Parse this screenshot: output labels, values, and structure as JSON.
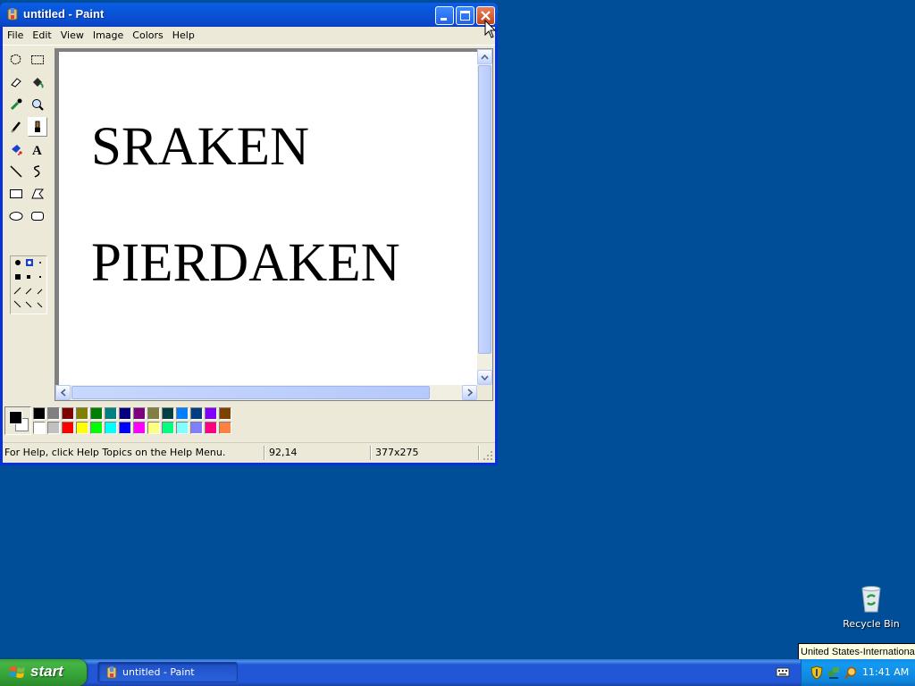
{
  "window": {
    "title": "untitled - Paint",
    "menu": [
      "File",
      "Edit",
      "View",
      "Image",
      "Colors",
      "Help"
    ]
  },
  "canvas": {
    "lines": [
      "SRAKEN",
      "PIERDAKEN"
    ]
  },
  "tools": [
    {
      "name": "free-form-select-icon"
    },
    {
      "name": "select-icon"
    },
    {
      "name": "eraser-icon"
    },
    {
      "name": "fill-icon"
    },
    {
      "name": "pick-color-icon"
    },
    {
      "name": "magnifier-icon"
    },
    {
      "name": "pencil-icon"
    },
    {
      "name": "brush-icon",
      "active": true
    },
    {
      "name": "airbrush-icon"
    },
    {
      "name": "text-icon"
    },
    {
      "name": "line-icon"
    },
    {
      "name": "curve-icon"
    },
    {
      "name": "rectangle-icon"
    },
    {
      "name": "polygon-icon"
    },
    {
      "name": "ellipse-icon"
    },
    {
      "name": "rounded-rectangle-icon"
    }
  ],
  "palette": {
    "foreground": "#000000",
    "background": "#ffffff",
    "top_row": [
      "#000000",
      "#808080",
      "#800000",
      "#808000",
      "#008000",
      "#008080",
      "#000080",
      "#800080",
      "#808040",
      "#004040",
      "#0080ff",
      "#004080",
      "#8000ff",
      "#804000"
    ],
    "bottom_row": [
      "#ffffff",
      "#c0c0c0",
      "#ff0000",
      "#ffff00",
      "#00ff00",
      "#00ffff",
      "#0000ff",
      "#ff00ff",
      "#ffff80",
      "#00ff80",
      "#80ffff",
      "#8080ff",
      "#ff0080",
      "#ff8040"
    ]
  },
  "status": {
    "help": "For Help, click Help Topics on the Help Menu.",
    "coords": "92,14",
    "size": "377x275"
  },
  "desktop": {
    "recycle_bin": "Recycle Bin",
    "tooltip": "United States-International"
  },
  "taskbar": {
    "start": "start",
    "task": "untitled - Paint",
    "clock": "11:41 AM"
  }
}
